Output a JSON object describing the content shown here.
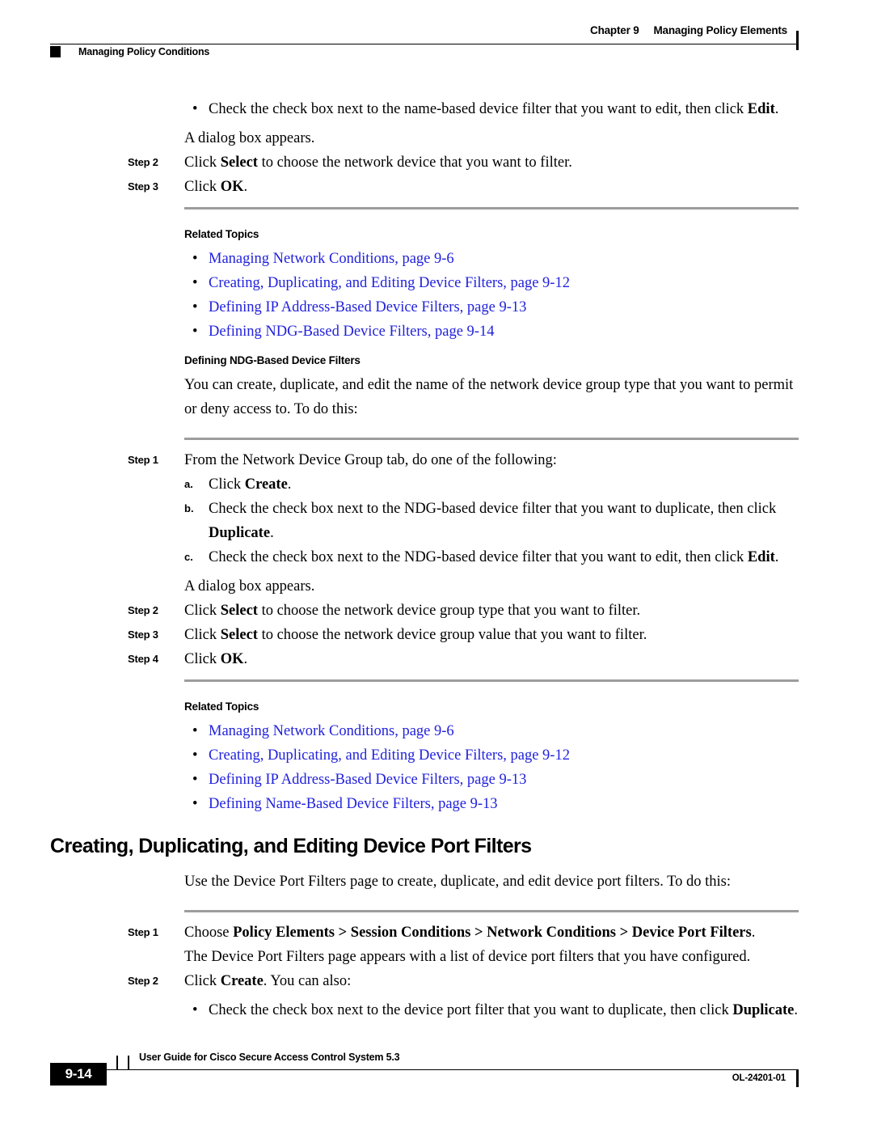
{
  "header": {
    "chapter_number": "Chapter 9",
    "chapter_title": "Managing Policy Elements",
    "section_title": "Managing Policy Conditions"
  },
  "colors": {
    "link": "#2222dd",
    "rule": "#9d9d9d",
    "text": "#000000"
  },
  "body": {
    "bullet_glyph": "•",
    "b1": {
      "text_1": "Check the check box next to the name-based device filter that you want to edit, then click ",
      "bold_1": "Edit",
      "text_2": "."
    },
    "p_dialog_1": "A dialog box appears.",
    "step2_label": "Step 2",
    "step2_text_1": "Click ",
    "step2_bold_1": "Select",
    "step2_text_2": " to choose the network device that you want to filter.",
    "step3_label": "Step 3",
    "step3_text_1": "Click ",
    "step3_bold_1": "OK",
    "step3_text_2": ".",
    "related_topics_heading_1": "Related Topics",
    "links_1": [
      "Managing Network Conditions, page 9-6",
      "Creating, Duplicating, and Editing Device Filters, page 9-12",
      "Defining IP Address-Based Device Filters, page 9-13",
      "Defining NDG-Based Device Filters, page 9-14"
    ],
    "ndg_heading": "Defining NDG-Based Device Filters",
    "ndg_intro": "You can create, duplicate, and edit the name of the network device group type that you want to permit or deny access to. To do this:",
    "ndg_step1_label": "Step 1",
    "ndg_step1_text": "From the Network Device Group tab, do one of the following:",
    "alpha_a_label": "a.",
    "alpha_a_text_1": "Click ",
    "alpha_a_bold_1": "Create",
    "alpha_a_text_2": ".",
    "alpha_b_label": "b.",
    "alpha_b_text_1": "Check the check box next to the NDG-based device filter that you want to duplicate, then click ",
    "alpha_b_bold_1": "Duplicate",
    "alpha_b_text_2": ".",
    "alpha_c_label": "c.",
    "alpha_c_text_1": "Check the check box next to the NDG-based device filter that you want to edit, then click ",
    "alpha_c_bold_1": "Edit",
    "alpha_c_text_2": ".",
    "p_dialog_2": "A dialog box appears.",
    "ndg_step2_label": "Step 2",
    "ndg_step2_text_1": "Click ",
    "ndg_step2_bold_1": "Select",
    "ndg_step2_text_2": " to choose the network device group type that you want to filter.",
    "ndg_step3_label": "Step 3",
    "ndg_step3_text_1": "Click ",
    "ndg_step3_bold_1": "Select",
    "ndg_step3_text_2": " to choose the network device group value that you want to filter.",
    "ndg_step4_label": "Step 4",
    "ndg_step4_text_1": "Click ",
    "ndg_step4_bold_1": "OK",
    "ndg_step4_text_2": ".",
    "related_topics_heading_2": "Related Topics",
    "links_2": [
      "Managing Network Conditions, page 9-6",
      "Creating, Duplicating, and Editing Device Filters, page 9-12",
      "Defining IP Address-Based Device Filters, page 9-13",
      "Defining Name-Based Device Filters, page 9-13"
    ],
    "section_heading": "Creating, Duplicating, and Editing Device Port Filters",
    "dpf_intro": "Use the Device Port Filters page to create, duplicate, and edit device port filters. To do this:",
    "dpf_step1_label": "Step 1",
    "dpf_step1_text_1": "Choose ",
    "dpf_step1_bold_1": "Policy Elements > Session Conditions > Network Conditions > Device Port Filters",
    "dpf_step1_text_2": ".",
    "dpf_result": "The Device Port Filters page appears with a list of device port filters that you have configured.",
    "dpf_step2_label": "Step 2",
    "dpf_step2_text_1": "Click ",
    "dpf_step2_bold_1": "Create",
    "dpf_step2_text_2": ". You can also:",
    "dpf_bullet_text_1": "Check the check box next to the device port filter that you want to duplicate, then click ",
    "dpf_bullet_bold_1": "Duplicate",
    "dpf_bullet_text_2": "."
  },
  "footer": {
    "guide_title": "User Guide for Cisco Secure Access Control System 5.3",
    "page_number": "9-14",
    "doc_id": "OL-24201-01"
  }
}
